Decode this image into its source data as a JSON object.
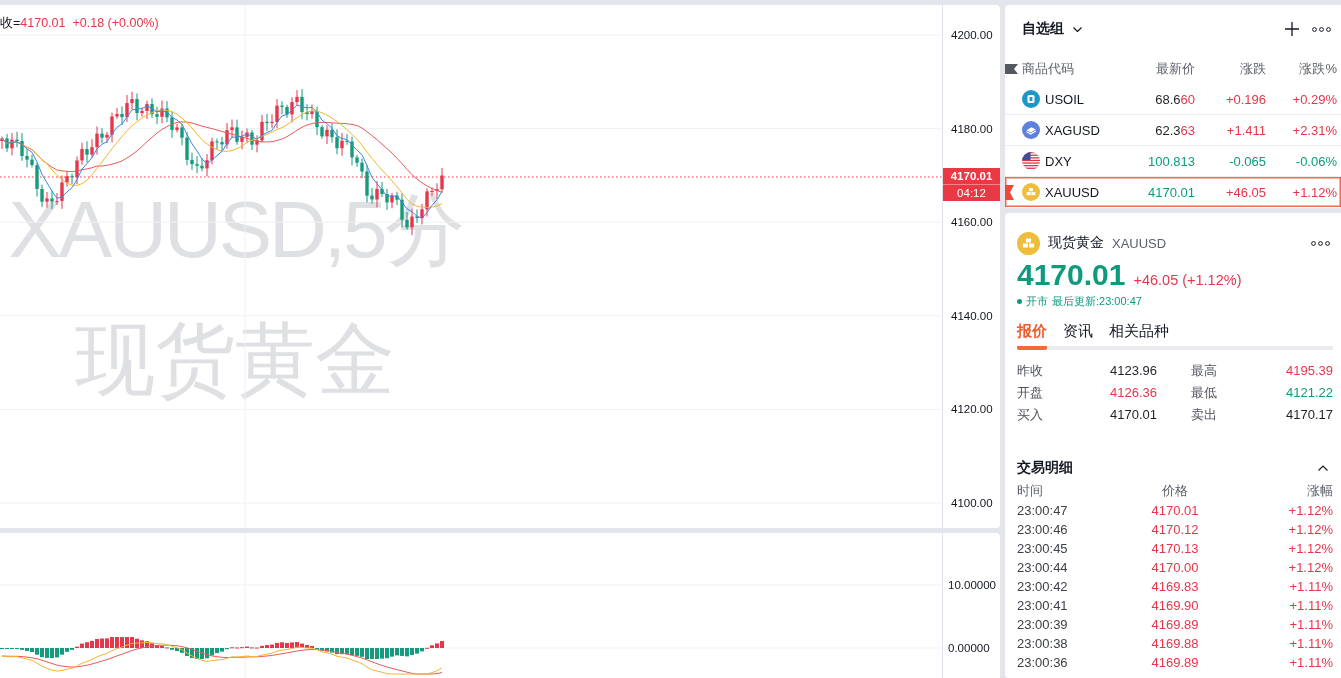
{
  "chart": {
    "legend": {
      "label": "收=",
      "value": {
        "text": "4170.01",
        "color": "#e5364b"
      },
      "change": {
        "text": "+0.18 (+0.00%)",
        "color": "#e5364b"
      }
    },
    "watermark": {
      "symbol_line": "XAUUSD,5分",
      "name_line": "现货黄金"
    },
    "price_axis": [
      "4200.00",
      "4180.00",
      "4160.00",
      "4140.00",
      "4120.00",
      "4100.00"
    ],
    "last_price": {
      "price": "4170.01",
      "countdown": "04:12"
    }
  },
  "indicator": {
    "axis": [
      "10.00000",
      "0.00000"
    ]
  },
  "watchlist": {
    "title": "自选组",
    "columns": [
      "商品代码",
      "最新价",
      "涨跌",
      "涨跌%"
    ],
    "rows": [
      {
        "kind": "energy",
        "symbol": "USOIL",
        "price_parts": [
          {
            "text": "68.6",
            "color": "#1f2229"
          },
          {
            "text": "60",
            "color": "#e5364b"
          }
        ],
        "change": {
          "text": "+0.196",
          "color": "#e5364b"
        },
        "change_pct": {
          "text": "+0.29%",
          "color": "#e5364b"
        },
        "selected": false
      },
      {
        "kind": "silver",
        "symbol": "XAGUSD",
        "price_parts": [
          {
            "text": "62.3",
            "color": "#1f2229"
          },
          {
            "text": "63",
            "color": "#e5364b"
          }
        ],
        "change": {
          "text": "+1.411",
          "color": "#e5364b"
        },
        "change_pct": {
          "text": "+2.31%",
          "color": "#e5364b"
        },
        "selected": false
      },
      {
        "kind": "currency",
        "symbol": "DXY",
        "price_parts": [
          {
            "text": "100.813",
            "color": "#0e9a7c"
          }
        ],
        "change": {
          "text": "-0.065",
          "color": "#0e9a7c"
        },
        "change_pct": {
          "text": "-0.06%",
          "color": "#0e9a7c"
        },
        "selected": false
      },
      {
        "kind": "gold",
        "symbol": "XAUUSD",
        "price_parts": [
          {
            "text": "4170.01",
            "color": "#0e9a7c"
          }
        ],
        "change": {
          "text": "+46.05",
          "color": "#e5364b"
        },
        "change_pct": {
          "text": "+1.12%",
          "color": "#e5364b"
        },
        "selected": true
      }
    ]
  },
  "detail": {
    "kind": "gold",
    "name": "现货黄金",
    "symbol": "XAUUSD",
    "price": {
      "text": "4170.01",
      "color": "#0e9a7c"
    },
    "change": {
      "text": "+46.05 (+1.12%)",
      "color": "#e5364b"
    },
    "status": {
      "open": true,
      "label": "开市",
      "updated": "最后更新:23:00:47"
    },
    "tabs": [
      {
        "label": "报价",
        "selected": true
      },
      {
        "label": "资讯",
        "selected": false
      },
      {
        "label": "相关品种",
        "selected": false
      }
    ],
    "stats": [
      {
        "label": "昨收",
        "value": "4123.96",
        "color": "#1f2229"
      },
      {
        "label": "最高",
        "value": "4195.39",
        "color": "#e5364b"
      },
      {
        "label": "开盘",
        "value": "4126.36",
        "color": "#e5364b"
      },
      {
        "label": "最低",
        "value": "4121.22",
        "color": "#0e9a7c"
      },
      {
        "label": "买入",
        "value": "4170.01",
        "color": "#1f2229"
      },
      {
        "label": "卖出",
        "value": "4170.17",
        "color": "#1f2229"
      }
    ],
    "trades": {
      "title": "交易明细",
      "expanded": true,
      "columns": [
        "时间",
        "价格",
        "涨幅"
      ],
      "rows": [
        {
          "time": "23:00:47",
          "price": "4170.01",
          "change_pct": "+1.12%",
          "color": "#e5364b"
        },
        {
          "time": "23:00:46",
          "price": "4170.12",
          "change_pct": "+1.12%",
          "color": "#e5364b"
        },
        {
          "time": "23:00:45",
          "price": "4170.13",
          "change_pct": "+1.12%",
          "color": "#e5364b"
        },
        {
          "time": "23:00:44",
          "price": "4170.00",
          "change_pct": "+1.12%",
          "color": "#e5364b"
        },
        {
          "time": "23:00:42",
          "price": "4169.83",
          "change_pct": "+1.11%",
          "color": "#e5364b"
        },
        {
          "time": "23:00:41",
          "price": "4169.90",
          "change_pct": "+1.11%",
          "color": "#e5364b"
        },
        {
          "time": "23:00:39",
          "price": "4169.89",
          "change_pct": "+1.11%",
          "color": "#e5364b"
        },
        {
          "time": "23:00:38",
          "price": "4169.88",
          "change_pct": "+1.11%",
          "color": "#e5364b"
        },
        {
          "time": "23:00:36",
          "price": "4169.89",
          "change_pct": "+1.11%",
          "color": "#e5364b"
        }
      ]
    }
  }
}
